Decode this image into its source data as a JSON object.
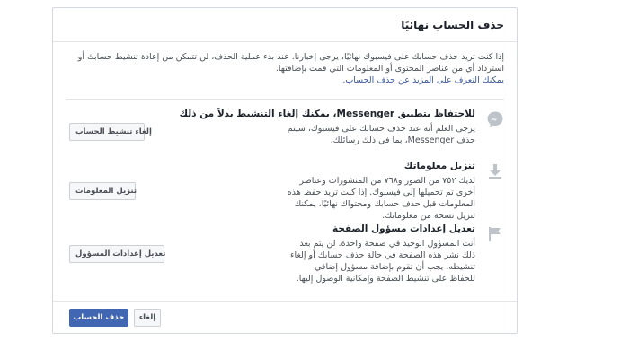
{
  "dialog": {
    "title": "حذف الحساب نهائيًا",
    "intro": "إذا كنت تريد حذف حسابك على فيسبوك نهائيًا، يرجى إخبارنا. عند بدء عملية الحذف، لن تتمكن من إعادة تنشيط حسابك أو استرداد أي من عناصر المحتوى أو المعلومات التي قمت بإضافتها.",
    "intro_link": "يمكنك التعرف على المزيد عن حذف الحساب."
  },
  "sections": [
    {
      "icon": "messenger-icon",
      "title": "للاحتفاظ بتطبيق Messenger، يمكنك إلغاء التنشيط بدلاً من ذلك",
      "body": "يرجى العلم أنه عند حذف حسابك على فيسبوك، سيتم حذف Messenger، بما في ذلك رسائلك.",
      "button": "إلغاء تنشيط الحساب"
    },
    {
      "icon": "download-icon",
      "title": "تنزيل معلوماتك",
      "body": "لديك ٧٥٢ من الصور و٧٦٨ من المنشورات وعناصر أخرى تم تحميلها إلى فيسبوك. إذا كنت تريد حفظ هذه المعلومات قبل حذف حسابك ومحتواك نهائيًا، يمكنك تنزيل نسخة من معلوماتك.",
      "button": "تنزيل المعلومات"
    },
    {
      "icon": "flag-icon",
      "title": "تعديل إعدادات مسؤول الصفحة",
      "body": "أنت المسؤول الوحيد في صفحة واحدة. لن يتم بعد ذلك نشر هذه الصفحة في حالة حذف حسابك أو إلغاء تنشيطه. يجب أن تقوم بإضافة مسؤول إضافي للحفاظ على تنشيط الصفحة وإمكانية الوصول إليها.",
      "button": "تعديل إعدادات المسؤول"
    }
  ],
  "footer": {
    "delete_label": "حذف الحساب",
    "cancel_label": "إلغاء"
  },
  "colors": {
    "primary": "#4267b2",
    "link": "#385898",
    "icon_gray": "#bec2c9"
  }
}
